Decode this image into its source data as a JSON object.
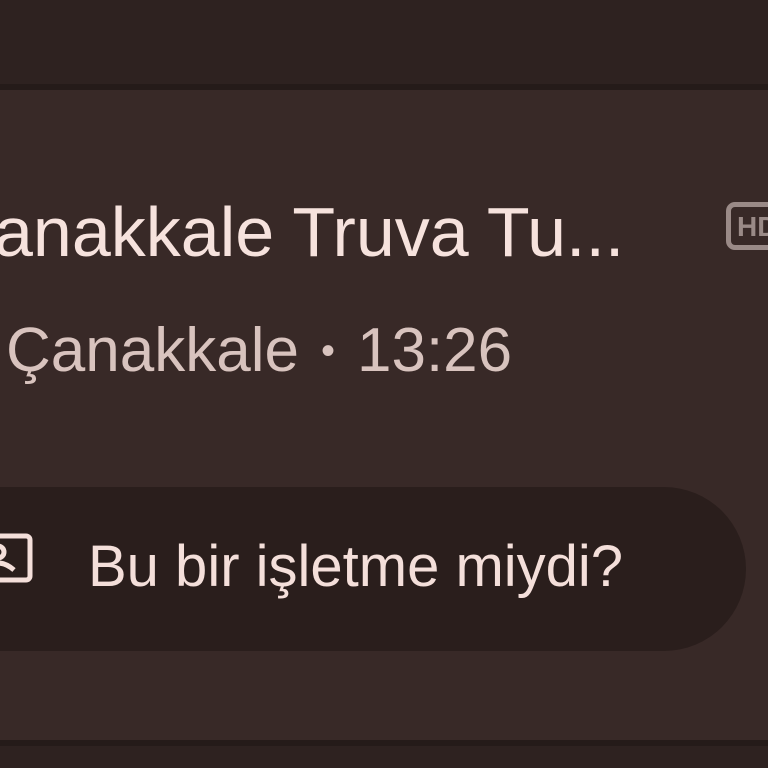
{
  "listing": {
    "title": "anakkale Truva Tu...",
    "hd_badge": "HD",
    "location": "Çanakkale",
    "separator": "•",
    "time": "13:26"
  },
  "prompt": {
    "label": "Bu bir işletme miydi?",
    "icon": "storefront-icon"
  },
  "colors": {
    "background": "#382927",
    "pill": "#2a1e1c",
    "text_primary": "#f6e2dd",
    "text_secondary": "#d8c3be"
  }
}
